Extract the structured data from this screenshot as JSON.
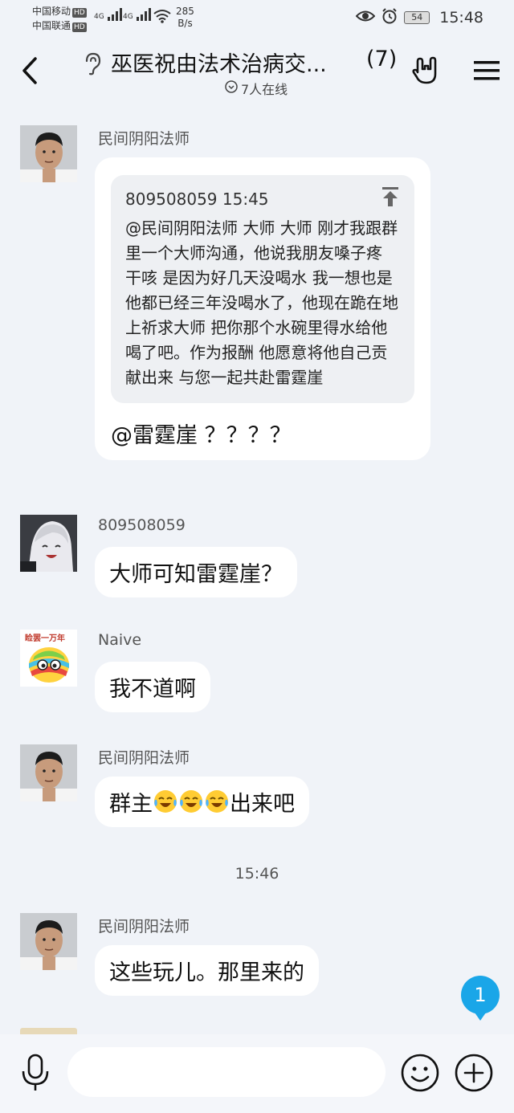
{
  "status_bar": {
    "carrier1": "中国移动",
    "carrier2": "中国联通",
    "hd_label": "HD",
    "signal_label": "4G",
    "net_speed_value": "285",
    "net_speed_unit": "B/s",
    "battery": "54",
    "time": "15:48",
    "icons": [
      "eye-icon",
      "alarm-icon",
      "battery-icon"
    ]
  },
  "header": {
    "title": "巫医祝由法术治病交...",
    "member_count": "(7)",
    "online_status": "7人在线",
    "icons": [
      "back-icon",
      "ear-icon",
      "rock-hand-icon",
      "menu-icon"
    ]
  },
  "messages": [
    {
      "sender": "民间阴阳法师",
      "avatar": "man-avatar",
      "quote": {
        "header": "809508059 15:45",
        "body": "@民间阴阳法师 大师 大师 刚才我跟群里一个大师沟通，他说我朋友嗓子疼 干咳 是因为好几天没喝水 我一想也是 他都已经三年没喝水了，他现在跪在地上祈求大师 把你那个水碗里得水给他喝了吧。作为报酬 他愿意将他自己贡献出来 与您一起共赴雷霆崖"
      },
      "text": "@雷霆崖 ？？？？"
    },
    {
      "sender": "809508059",
      "avatar": "anime-avatar",
      "text": "大师可知雷霆崖？"
    },
    {
      "sender": "Naive",
      "avatar": "egg-avatar",
      "avatar_caption": "睑罢一万年",
      "text": "我不道啊"
    },
    {
      "sender": "民间阴阳法师",
      "avatar": "man-avatar",
      "text_prefix": "群主",
      "emojis": [
        "crying-laugh-emoji",
        "crying-laugh-emoji",
        "crying-laugh-emoji"
      ],
      "text_suffix": "出来吧"
    },
    {
      "timestamp": "15:46"
    },
    {
      "sender": "民间阴阳法师",
      "avatar": "man-avatar",
      "text": "这些玩儿。那里来的"
    }
  ],
  "unread_badge": "1",
  "input_bar": {
    "placeholder": "",
    "icons": [
      "microphone-icon",
      "emoji-icon",
      "plus-icon"
    ]
  },
  "colors": {
    "background": "#f0f3f8",
    "bubble": "#ffffff",
    "quote_bg": "#eef0f3",
    "badge": "#1aa6e8"
  }
}
